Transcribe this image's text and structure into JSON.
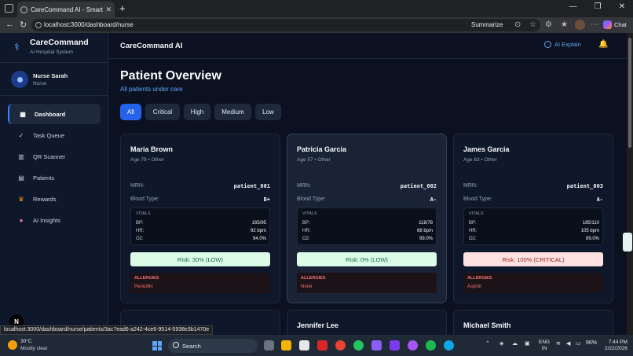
{
  "browser": {
    "tab_title": "CareCommand AI - Smart Digital H",
    "url": "localhost:3000/dashboard/nurse",
    "summarize_label": "Summarize",
    "copilot_label": "Chat",
    "status_url": "localhost:3000/dashboard/nurse/patients/3ac7ead6-a242-4ce6-9514-5938e3b1470e"
  },
  "brand": {
    "title": "CareCommand",
    "subtitle": "AI Hospital System"
  },
  "user": {
    "name": "Nurse Sarah",
    "role": "Nurse"
  },
  "sidebar": {
    "items": [
      {
        "label": "Dashboard",
        "icon": "dashboard-icon",
        "active": true
      },
      {
        "label": "Task Queue",
        "icon": "check-icon"
      },
      {
        "label": "QR Scanner",
        "icon": "qr-icon"
      },
      {
        "label": "Patients",
        "icon": "patients-icon"
      },
      {
        "label": "Rewards",
        "icon": "trophy-icon"
      },
      {
        "label": "AI Insights",
        "icon": "brain-icon"
      }
    ]
  },
  "topbar": {
    "title": "CareCommand AI",
    "ai_explain": "AI Explain"
  },
  "page": {
    "title": "Patient Overview",
    "subtitle": "All patients under care"
  },
  "filters": [
    "All",
    "Critical",
    "High",
    "Medium",
    "Low"
  ],
  "labels": {
    "mrn": "MRN:",
    "blood": "Blood Type:",
    "vitals": "VITALS",
    "bp": "BP:",
    "hr": "HR:",
    "o2": "O2:",
    "allergies": "ALLERGIES"
  },
  "patients": [
    {
      "name": "Maria Brown",
      "meta": "Age 79 • Other",
      "mrn": "patient_001",
      "blood": "B+",
      "bp": "165/95",
      "hr": "92 bpm",
      "o2": "94.0%",
      "risk": "Risk: 30% (LOW)",
      "risk_level": "low",
      "allergies": "Penicillin"
    },
    {
      "name": "Patricia Garcia",
      "meta": "Age 57 • Other",
      "mrn": "patient_002",
      "blood": "A-",
      "bp": "118/78",
      "hr": "68 bpm",
      "o2": "99.0%",
      "risk": "Risk: 0% (LOW)",
      "risk_level": "low",
      "allergies": "None"
    },
    {
      "name": "James Garcia",
      "meta": "Age 83 • Other",
      "mrn": "patient_003",
      "blood": "A-",
      "bp": "185/110",
      "hr": "105 bpm",
      "o2": "89.0%",
      "risk": "Risk: 100% (CRITICAL)",
      "risk_level": "critical",
      "allergies": "Aspirin"
    }
  ],
  "next_patients": [
    "Jennifer Lee",
    "Michael Smith"
  ],
  "taskbar": {
    "temp": "30°C",
    "weather": "Mostly clear",
    "search": "Search",
    "lang1": "ENG",
    "lang2": "IN",
    "battery": "96%",
    "time": "7:44 PM",
    "date": "2/22/2026"
  },
  "colors": {
    "accent": "#2563eb",
    "risk_low_bg": "#dcfce7",
    "risk_critical_bg": "#fee2e2",
    "allergy": "#f87171"
  }
}
